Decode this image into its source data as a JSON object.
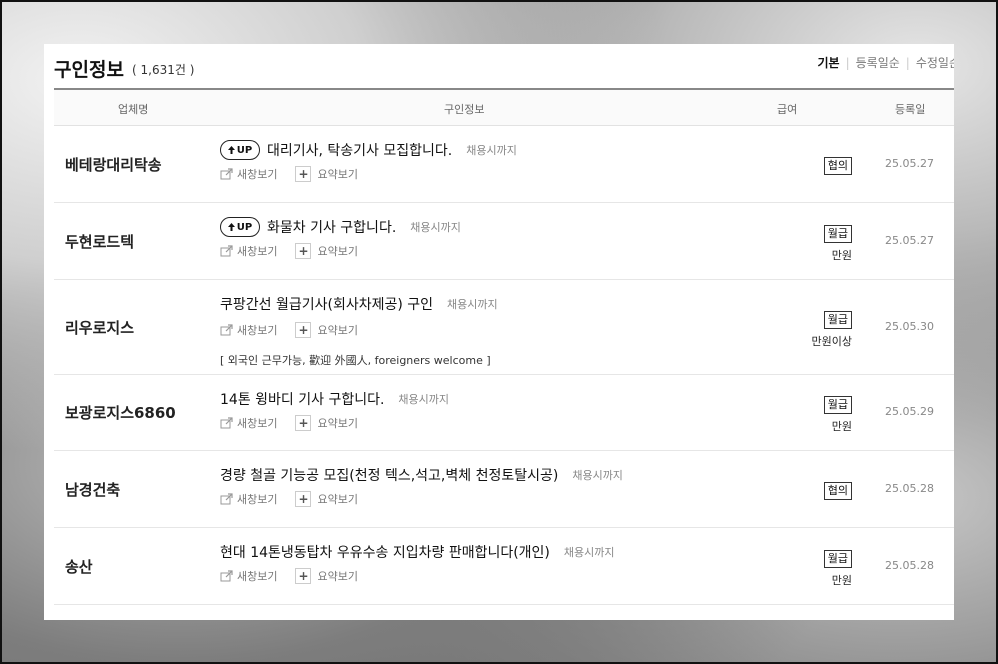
{
  "header": {
    "title": "구인정보",
    "count": "( 1,631건 )",
    "sort_tabs": [
      "기본",
      "등록일순",
      "수정일순"
    ]
  },
  "table_headers": {
    "company": "업체명",
    "info": "구인정보",
    "salary": "급여",
    "date": "등록일"
  },
  "labels": {
    "up": "UP",
    "new_window": "새창보기",
    "summary": "요약보기"
  },
  "rows": [
    {
      "company": "베테랑대리탁송",
      "up": true,
      "title": "대리기사, 탁송기사 모집합니다.",
      "deadline": "채용시까지",
      "salary_type": "협의",
      "salary_amount": "",
      "date": "25.05.27",
      "note": ""
    },
    {
      "company": "두현로드텍",
      "up": true,
      "title": "화물차 기사 구합니다.",
      "deadline": "채용시까지",
      "salary_type": "월급",
      "salary_amount": "만원",
      "date": "25.05.27",
      "note": ""
    },
    {
      "company": "리우로지스",
      "up": false,
      "title": "쿠팡간선 월급기사(회사차제공) 구인",
      "deadline": "채용시까지",
      "salary_type": "월급",
      "salary_amount": "만원이상",
      "date": "25.05.30",
      "note": "[ 외국인 근무가능, 歡迎 外國人, foreigners welcome ]"
    },
    {
      "company": "보광로지스6860",
      "up": false,
      "title": "14톤 윙바디 기사 구합니다.",
      "deadline": "채용시까지",
      "salary_type": "월급",
      "salary_amount": "만원",
      "date": "25.05.29",
      "note": ""
    },
    {
      "company": "남경건축",
      "up": false,
      "title": "경량 철골 기능공 모집(천정 텍스,석고,벽체 천정토탈시공)",
      "deadline": "채용시까지",
      "salary_type": "협의",
      "salary_amount": "",
      "date": "25.05.28",
      "note": ""
    },
    {
      "company": "송산",
      "up": false,
      "title": "현대 14톤냉동탑차 우유수송 지입차량 판매합니다(개인)",
      "deadline": "채용시까지",
      "salary_type": "월급",
      "salary_amount": "만원",
      "date": "25.05.28",
      "note": ""
    }
  ]
}
